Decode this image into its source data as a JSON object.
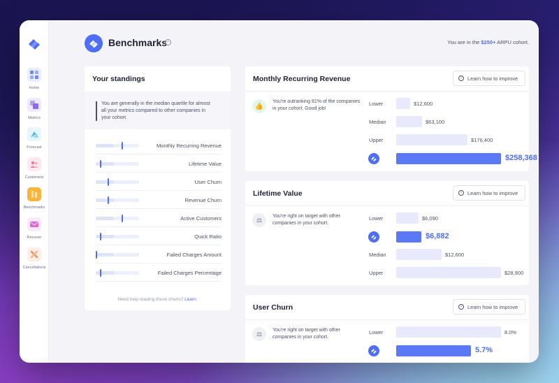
{
  "sidebar": {
    "items": [
      {
        "label": "Home",
        "icon": "home-icon",
        "color": "#6f86f3"
      },
      {
        "label": "Metrics",
        "icon": "metrics-icon",
        "color": "#8b6cf0"
      },
      {
        "label": "Forecast",
        "icon": "forecast-icon",
        "color": "#41b7e0"
      },
      {
        "label": "Customers",
        "icon": "customers-icon",
        "color": "#f07a9a"
      },
      {
        "label": "Benchmarks",
        "icon": "benchmarks-icon",
        "color": "#f7b53b"
      },
      {
        "label": "Recover",
        "icon": "recover-icon",
        "color": "#d96ad8"
      },
      {
        "label": "Cancellations",
        "icon": "cancellations-icon",
        "color": "#f08a5a"
      }
    ],
    "active": "Benchmarks"
  },
  "header": {
    "title": "Benchmarks",
    "cohort_prefix": "You are in the ",
    "cohort_value": "$250+",
    "cohort_suffix": " ARPU cohort."
  },
  "standings": {
    "title": "Your standings",
    "summary": "You are generally in the median quartile for almost all your metrics compared to other companies in your cohort.",
    "rows": [
      {
        "label": "Monthly Recurring Revenue",
        "position": 0.62
      },
      {
        "label": "Lifetime Value",
        "position": 0.1
      },
      {
        "label": "User Churn",
        "position": 0.28
      },
      {
        "label": "Revenue Churn",
        "position": 0.28
      },
      {
        "label": "Active Customers",
        "position": 0.62
      },
      {
        "label": "Quick Ratio",
        "position": 0.1
      },
      {
        "label": "Failed Charges Amount",
        "position": 0.0
      },
      {
        "label": "Failed Charges Percentage",
        "position": 0.1
      }
    ],
    "help_prefix": "Need help reading these charts? ",
    "help_link": "Learn."
  },
  "metrics": [
    {
      "title": "Monthly Recurring Revenue",
      "learn_label": "Learn how to improve",
      "message": "You're outranking 81% of the companies in your cohort. Good job!",
      "message_icon": "thumbs-up-icon",
      "benchmarks": [
        {
          "label": "Lower",
          "value": "$12,600",
          "amount": 12600
        },
        {
          "label": "Median",
          "value": "$63,100",
          "amount": 63100
        },
        {
          "label": "Upper",
          "value": "$176,400",
          "amount": 176400
        }
      ],
      "you": {
        "value": "$258,368",
        "amount": 258368
      }
    },
    {
      "title": "Lifetime Value",
      "learn_label": "Learn how to improve",
      "message": "You're right on target with other companies in your cohort.",
      "message_icon": "scale-icon",
      "benchmarks": [
        {
          "label": "Lower",
          "value": "$6,090",
          "amount": 6090
        },
        {
          "label": "Median",
          "value": "$12,600",
          "amount": 12600
        },
        {
          "label": "Upper",
          "value": "$28,900",
          "amount": 28900
        }
      ],
      "you": {
        "value": "$6,882",
        "amount": 6882
      }
    },
    {
      "title": "User Churn",
      "learn_label": "Learn how to improve",
      "message": "You're right on target with other companies in your cohort.",
      "message_icon": "scale-icon",
      "benchmarks": [
        {
          "label": "Lower",
          "value": "8.0%",
          "amount": 8.0
        }
      ],
      "you": {
        "value": "5.7%",
        "amount": 5.7
      }
    }
  ]
}
